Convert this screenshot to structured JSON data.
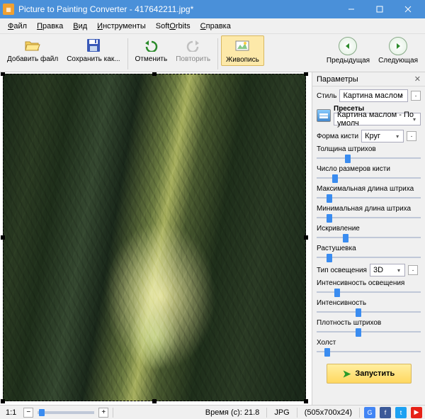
{
  "window": {
    "title": "Picture to Painting Converter - 417642211.jpg*"
  },
  "menu": {
    "file": "Файл",
    "edit": "Правка",
    "view": "Вид",
    "tools": "Инструменты",
    "softorbits": "SoftOrbits",
    "help": "Справка"
  },
  "toolbar": {
    "add_file": "Добавить\nфайл",
    "save_as": "Сохранить\nкак...",
    "undo": "Отменить",
    "redo": "Повторить",
    "painting": "Живопись",
    "prev": "Предыдущая",
    "next": "Следующая"
  },
  "panel": {
    "title": "Параметры",
    "style_label": "Стиль",
    "style_value": "Картина маслом",
    "presets_label": "Пресеты",
    "preset_value": "Картина маслом - По умолч",
    "brush_shape_label": "Форма кисти",
    "brush_shape_value": "Круг",
    "lighting_type_label": "Тип освещения",
    "lighting_type_value": "3D",
    "sliders": {
      "stroke_thickness": {
        "label": "Толщина штрихов",
        "value": 30
      },
      "brush_sizes": {
        "label": "Число размеров кисти",
        "value": 18
      },
      "max_stroke_len": {
        "label": "Максимальная длина штриха",
        "value": 12
      },
      "min_stroke_len": {
        "label": "Минимальная длина штриха",
        "value": 12
      },
      "curvature": {
        "label": "Искривление",
        "value": 28
      },
      "feather": {
        "label": "Растушевка",
        "value": 12
      },
      "light_intensity": {
        "label": "Интенсивность освещения",
        "value": 20
      },
      "intensity": {
        "label": "Интенсивность",
        "value": 40
      },
      "stroke_density": {
        "label": "Плотность штрихов",
        "value": 40
      },
      "canvas": {
        "label": "Холст",
        "value": 10
      }
    },
    "run": "Запустить"
  },
  "status": {
    "ratio": "1:1",
    "time_label": "Время (с):",
    "time_value": "21.8",
    "format": "JPG",
    "dims": "(505x700x24)"
  },
  "colors": {
    "accent": "#3a8cf0",
    "titlebar": "#4a90d9",
    "run_bg": "#ffd860"
  }
}
